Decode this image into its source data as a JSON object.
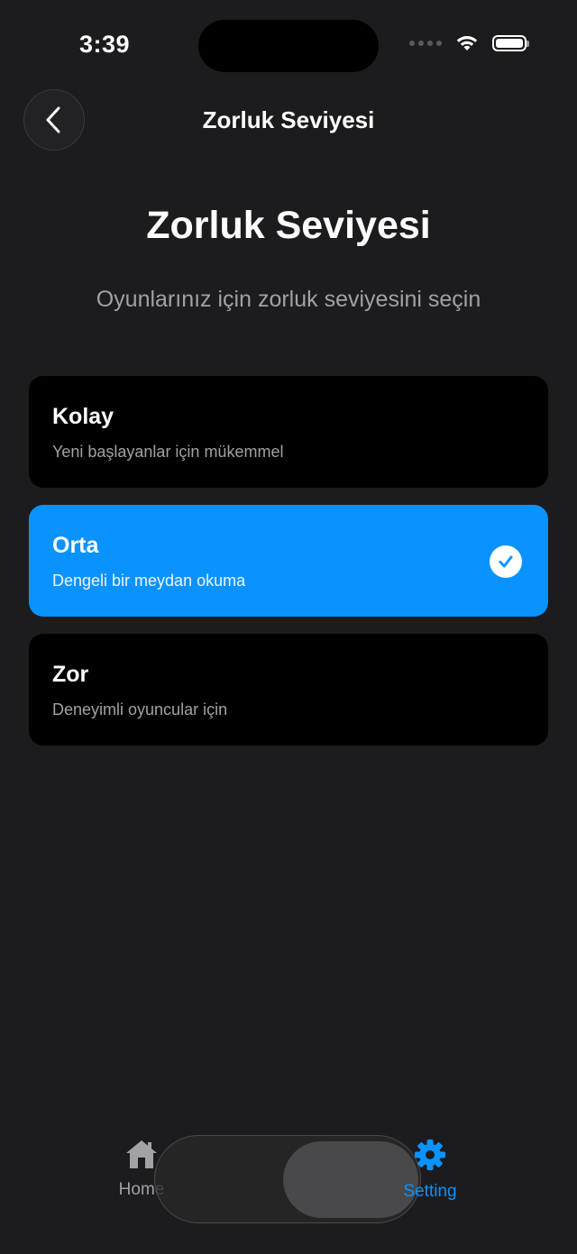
{
  "status_bar": {
    "time": "3:39"
  },
  "nav": {
    "title": "Zorluk Seviyesi",
    "back_icon": "chevron-left-icon"
  },
  "header": {
    "title": "Zorluk Seviyesi",
    "subtitle": "Oyunlarınız için zorluk seviyesini seçin"
  },
  "options": [
    {
      "title": "Kolay",
      "description": "Yeni başlayanlar için mükemmel",
      "selected": false
    },
    {
      "title": "Orta",
      "description": "Dengeli bir meydan okuma",
      "selected": true
    },
    {
      "title": "Zor",
      "description": "Deneyimli oyuncular için",
      "selected": false
    }
  ],
  "tab_bar": {
    "items": [
      {
        "label": "Home",
        "icon": "house-icon",
        "active": false
      },
      {
        "label": "Setting",
        "icon": "gear-icon",
        "active": true
      }
    ]
  },
  "colors": {
    "background": "#1c1c1e",
    "accent": "#0a93ff",
    "card": "#000000",
    "secondary_text": "#a1a1a6"
  }
}
